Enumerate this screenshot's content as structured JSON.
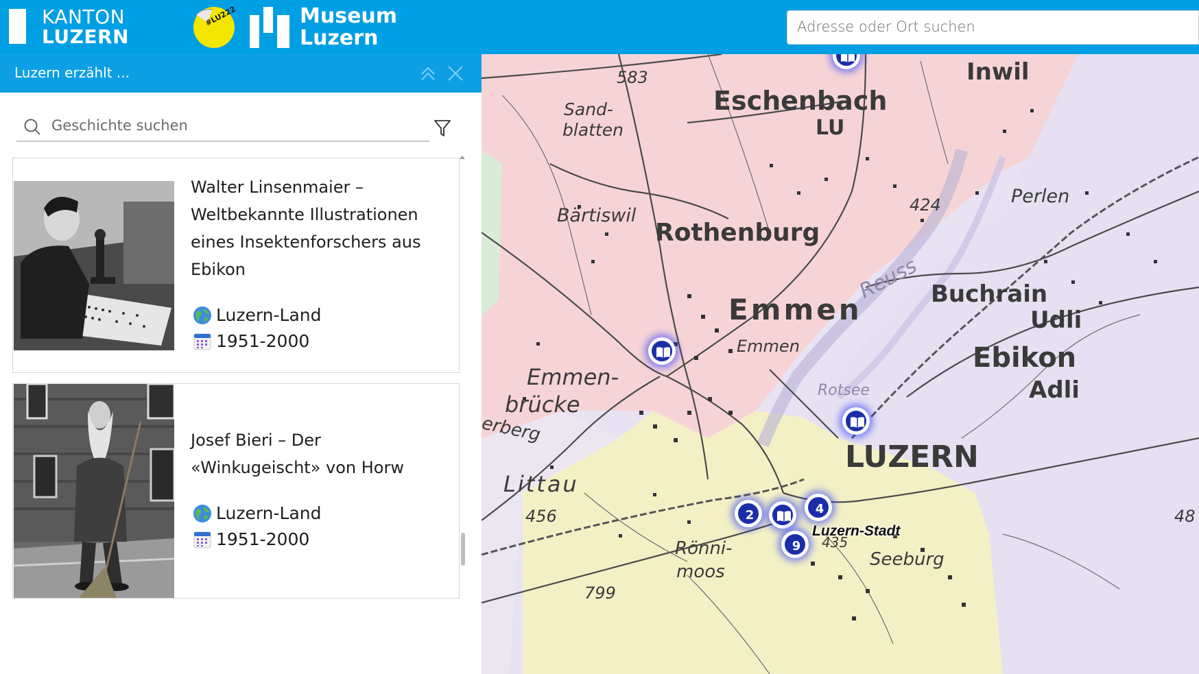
{
  "header": {
    "kanton_line1": "KANTON",
    "kanton_line2": "LUZERN",
    "badge_text": "#LU222",
    "museum_line1": "Museum",
    "museum_line2": "Luzern",
    "search_placeholder": "Adresse oder Ort suchen"
  },
  "panel": {
    "title": "Luzern erzählt ...",
    "search_placeholder": "Geschichte suchen",
    "stories": [
      {
        "title": "Walter Linsenmaier – Weltbekannte Illustrationen eines Insektenforschers aus Ebikon",
        "region": "Luzern-Land",
        "period": "1951-2000"
      },
      {
        "title": "Josef Bieri – Der «Winkugeischt» von Horw",
        "region": "Luzern-Land",
        "period": "1951-2000"
      }
    ]
  },
  "map": {
    "places": {
      "eschenbach": "Eschenbach",
      "lu": "LU",
      "inwil": "Inwil",
      "sandblatten1": "Sand-",
      "sandblatten2": "blatten",
      "h583": "583",
      "baertiswil": "Bärtiswil",
      "rothenburg": "Rothenburg",
      "perlen": "Perlen",
      "h424": "424",
      "emmen_big": "Emmen",
      "emmen_small": "Emmen",
      "reuss": "Reuss",
      "buchrain": "Buchrain",
      "udli": "Udli",
      "ebikon": "Ebikon",
      "adli": "Adli",
      "emmenbruecke1": "Emmen-",
      "emmenbruecke2": "brücke",
      "rotsee": "Rotsee",
      "erberg": "erberg",
      "luzern": "LUZERN",
      "littau": "Littau",
      "h456": "456",
      "h48": "48",
      "roenni1": "Rönni-",
      "roenni2": "moos",
      "h435": "435",
      "seeburg": "Seeburg",
      "h799": "799",
      "luzern_stadt": "Luzern-Stadt"
    },
    "markers": {
      "m2": "2",
      "m4": "4",
      "m9": "9"
    },
    "colors": {
      "zone_north": "#f6d4d6",
      "zone_east": "#e6e0f2",
      "zone_city": "#f4f0c6",
      "zone_west": "#e8e2f2",
      "marker": "#1b2ea8"
    }
  }
}
